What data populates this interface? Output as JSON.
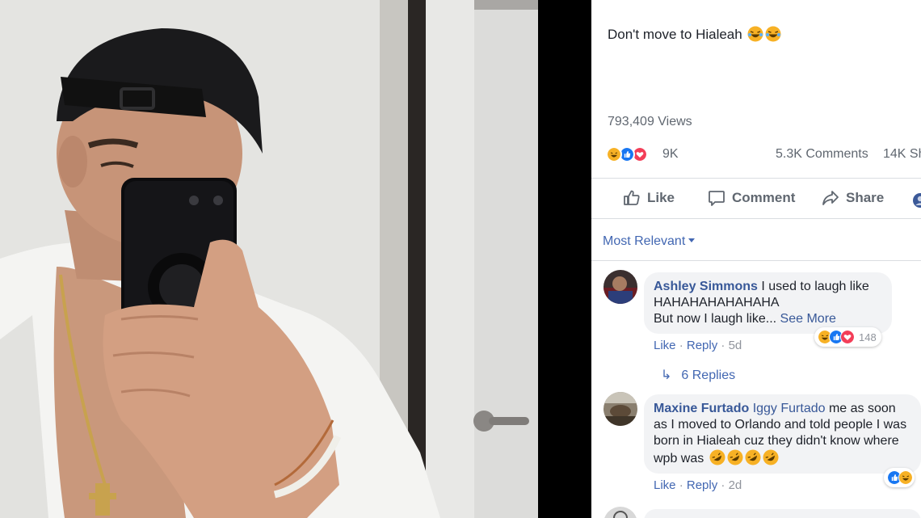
{
  "post": {
    "caption": "Don't move to Hialeah",
    "caption_emojis": [
      "laughing-tears-emoji",
      "laughing-tears-emoji"
    ],
    "views": "793,409 Views",
    "reactions_count": "9K",
    "reaction_types": [
      "haha",
      "like",
      "love"
    ],
    "comments_count": "5.3K Comments",
    "shares_count": "14K Sh"
  },
  "actions": {
    "like": "Like",
    "comment": "Comment",
    "share": "Share"
  },
  "sort": {
    "label": "Most Relevant"
  },
  "comments": [
    {
      "author": "Ashley Simmons",
      "text_line1": "I used to laugh like",
      "text_line2": "HAHAHAHAHAHAHA",
      "text_line3": "But now I laugh like...",
      "see_more": "See More",
      "like": "Like",
      "reply": "Reply",
      "time": "5d",
      "reaction_count": "148",
      "reaction_types": [
        "haha",
        "like",
        "love"
      ],
      "replies": "6 Replies"
    },
    {
      "author": "Maxine Furtado",
      "tagged": "Iggy Furtado",
      "text_line1": "me as soon",
      "text_line2": "as I moved to Orlando and told people I was",
      "text_line3": "born in Hialeah cuz they didn't know where",
      "text_line4": "wpb was",
      "text_emojis": [
        "rofl-emoji",
        "rofl-emoji",
        "rofl-emoji",
        "rofl-emoji"
      ],
      "like": "Like",
      "reply": "Reply",
      "time": "2d",
      "reaction_types": [
        "like",
        "haha"
      ]
    }
  ],
  "colors": {
    "link_blue": "#385898",
    "accent_blue": "#4267b2",
    "muted": "#606770",
    "bubble_bg": "#f2f3f5",
    "like_blue": "#1877f2",
    "love_red": "#f33e58",
    "haha_yellow": "#f7b125"
  }
}
